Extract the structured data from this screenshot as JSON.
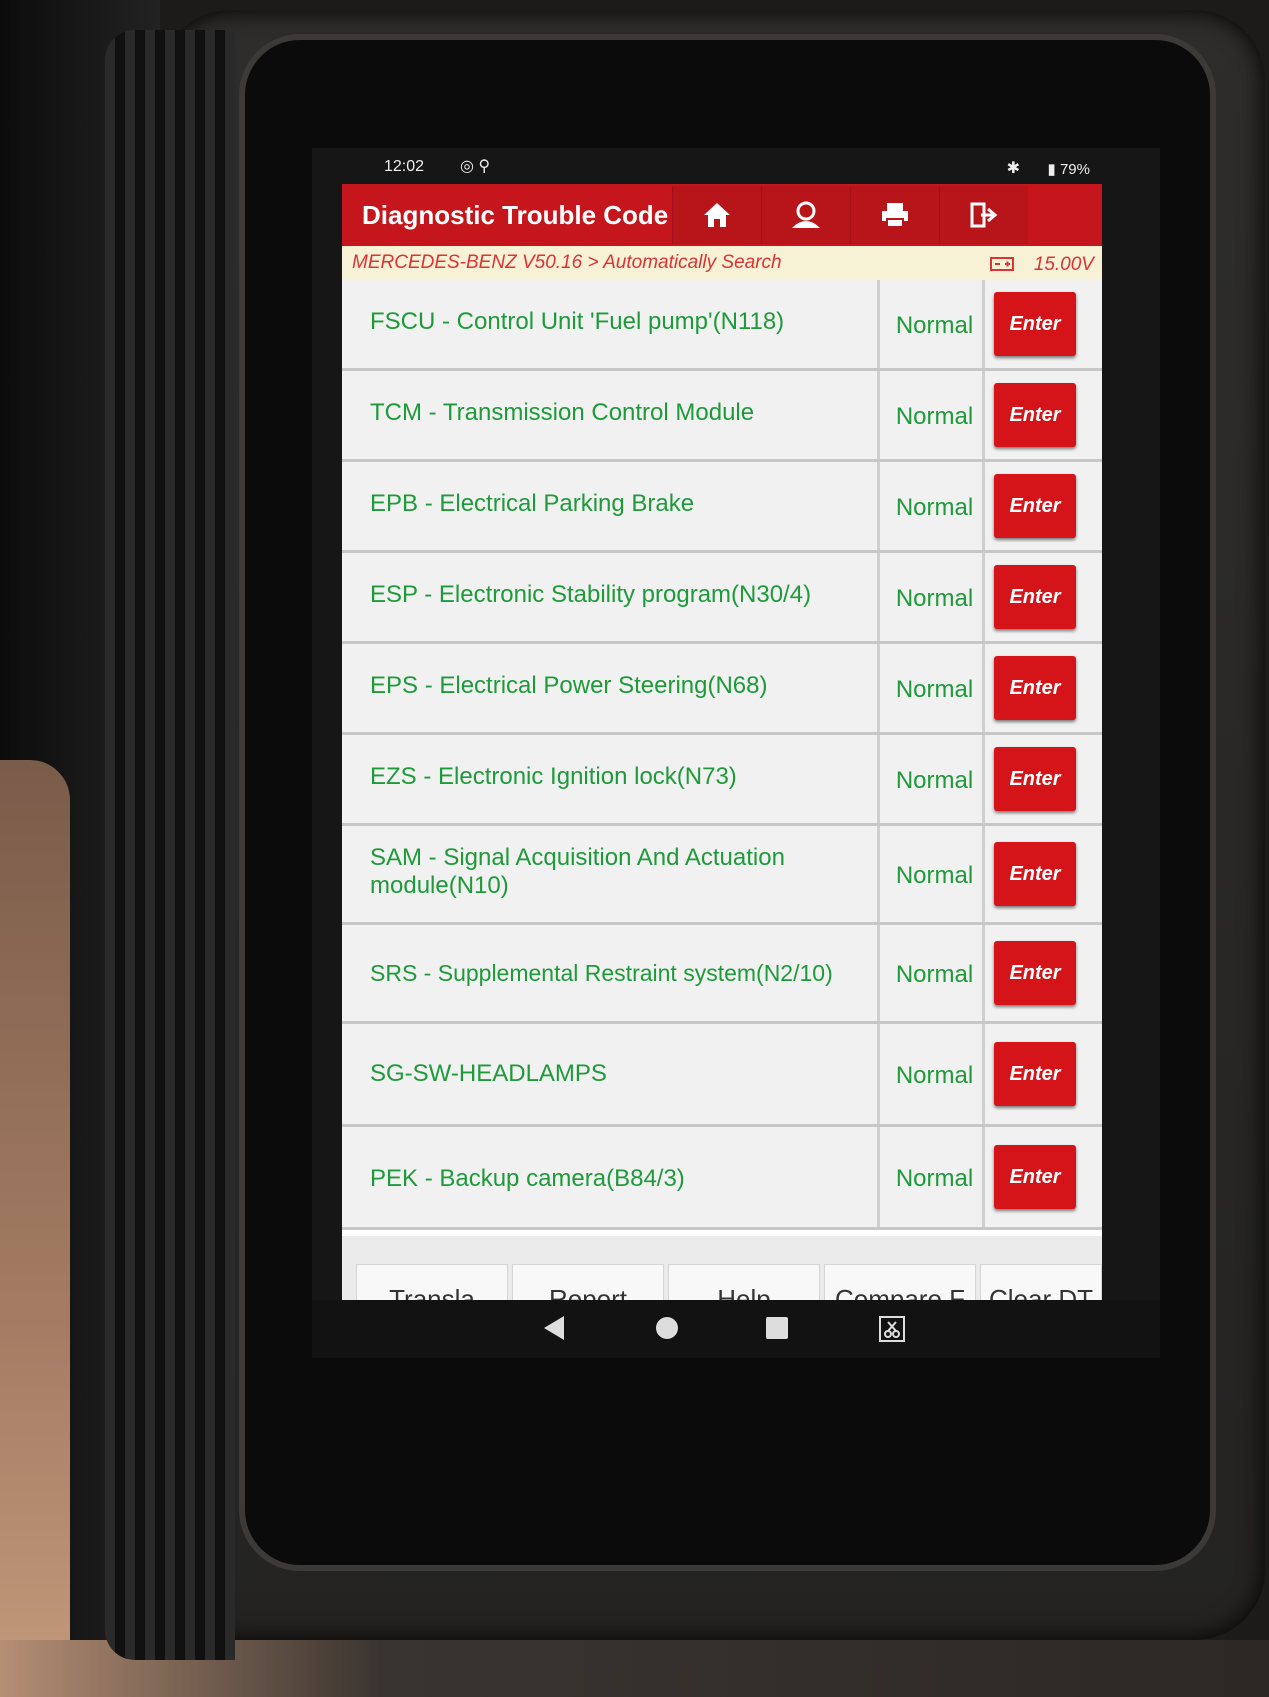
{
  "status": {
    "time": "12:02",
    "battery": "79%"
  },
  "header": {
    "title": "Diagnostic Trouble Code"
  },
  "breadcrumb": {
    "path": "MERCEDES-BENZ V50.16 > Automatically Search",
    "voltage": "15.00V"
  },
  "rows": [
    {
      "name": "FSCU - Control Unit 'Fuel pump'(N118)",
      "status": "Normal",
      "action": "Enter"
    },
    {
      "name": "TCM - Transmission Control Module",
      "status": "Normal",
      "action": "Enter"
    },
    {
      "name": "EPB - Electrical Parking Brake",
      "status": "Normal",
      "action": "Enter"
    },
    {
      "name": "ESP - Electronic Stability program(N30/4)",
      "status": "Normal",
      "action": "Enter"
    },
    {
      "name": "EPS - Electrical Power Steering(N68)",
      "status": "Normal",
      "action": "Enter"
    },
    {
      "name": "EZS - Electronic Ignition lock(N73)",
      "status": "Normal",
      "action": "Enter"
    },
    {
      "name": "SAM - Signal Acquisition And Actuation module(N10)",
      "status": "Normal",
      "action": "Enter"
    },
    {
      "name": "SRS - Supplemental Restraint system(N2/10)",
      "status": "Normal",
      "action": "Enter"
    },
    {
      "name": "SG-SW-HEADLAMPS",
      "status": "Normal",
      "action": "Enter"
    },
    {
      "name": "PEK - Backup camera(B84/3)",
      "status": "Normal",
      "action": "Enter"
    }
  ],
  "bottom_buttons": [
    "Transla",
    "Report",
    "Help",
    "Compare F",
    "Clear DT"
  ],
  "toolbar_icons": [
    "home-icon",
    "user-icon",
    "print-icon",
    "exit-icon"
  ],
  "colors": {
    "title_bar": "#c4161c",
    "text_green": "#1f9a3a",
    "enter_button": "#d41419"
  }
}
